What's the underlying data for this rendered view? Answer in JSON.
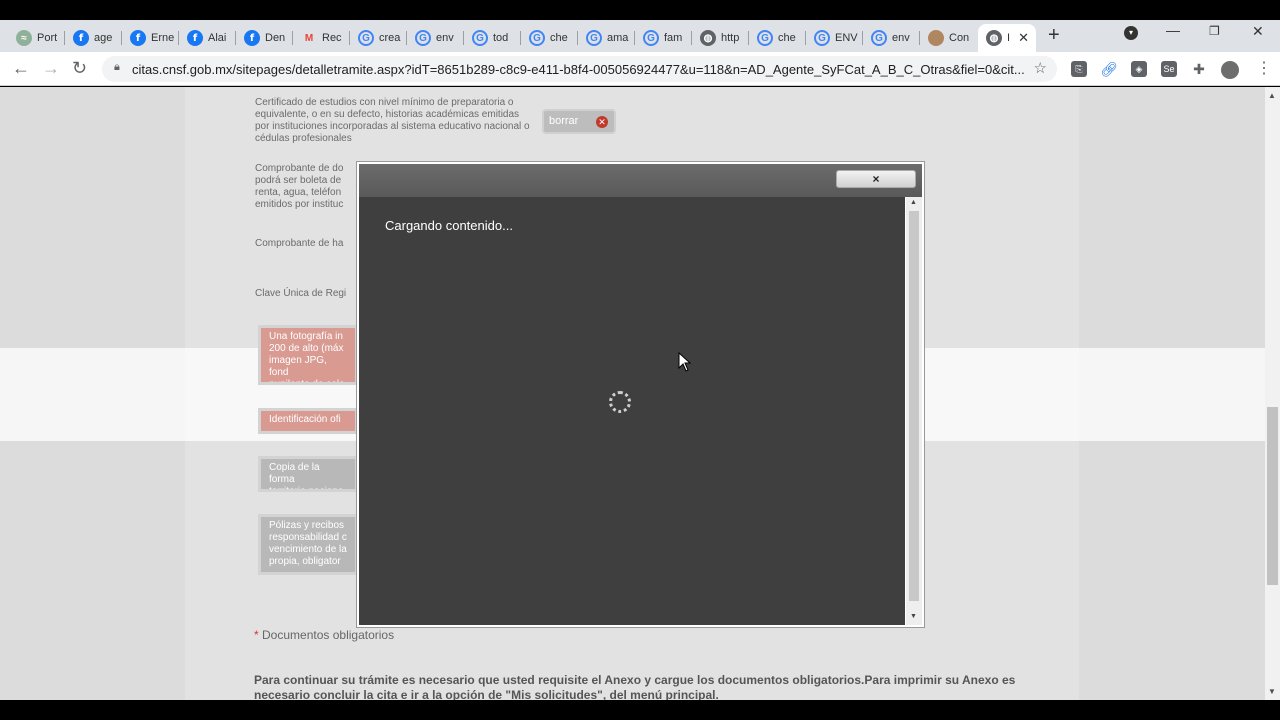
{
  "browser": {
    "tabs": [
      {
        "label": "Port",
        "icon": "meadow-logo-icon"
      },
      {
        "label": "age",
        "icon": "facebook-icon"
      },
      {
        "label": "Erne",
        "icon": "facebook-icon"
      },
      {
        "label": "Alai",
        "icon": "facebook-icon"
      },
      {
        "label": "Den",
        "icon": "facebook-icon"
      },
      {
        "label": "Rec",
        "icon": "gmail-icon"
      },
      {
        "label": "crea",
        "icon": "google-icon"
      },
      {
        "label": "env",
        "icon": "google-icon"
      },
      {
        "label": "tod",
        "icon": "google-icon"
      },
      {
        "label": "che",
        "icon": "google-icon"
      },
      {
        "label": "ama",
        "icon": "google-icon"
      },
      {
        "label": "fam",
        "icon": "google-icon"
      },
      {
        "label": "http",
        "icon": "globe-icon"
      },
      {
        "label": "che",
        "icon": "google-icon"
      },
      {
        "label": "ENV",
        "icon": "google-icon"
      },
      {
        "label": "env",
        "icon": "google-icon"
      },
      {
        "label": "Con",
        "icon": "circle-icon"
      },
      {
        "label": "I",
        "icon": "globe-icon"
      }
    ],
    "url": "citas.cnsf.gob.mx/sitepages/detalletramite.aspx?idT=8651b289-c8c9-e411-b8f4-005056924477&u=118&n=AD_Agente_SyFCat_A_B_C_Otras&fiel=0&cit..."
  },
  "page": {
    "doc_certificado": "Certificado de estudios con nivel mínimo de preparatoria o equivalente, o en su defecto, historias académicas emitidas por instituciones incorporadas al sistema educativo nacional o cédulas profesionales",
    "borrar_label": "borrar",
    "doc_comprobante_dom": "Comprobante de do\npodrá ser boleta de\nrenta, agua, teléfon\nemitidos por instituc",
    "doc_comprobante_ha": "Comprobante de ha",
    "doc_curp": "Clave Única de Regi",
    "req_foto": "Una fotografía in\n200 de alto (máx\nimagen JPG, fond\npupilente de colo",
    "req_identificacion": "Identificación ofi",
    "req_copia": "Copia de la forma\nterritorio naciona",
    "req_polizas": "Pólizas y recibos\nresponsabilidad c\nvencimiento de la\npropia, obligator",
    "oblig_asterisk": "*",
    "oblig_label": "Documentos obligatorios",
    "instructions": "Para continuar su trámite es necesario que usted requisite el Anexo y cargue los documentos obligatorios.Para imprimir su Anexo es necesario concluir la cita e ir a la opción de \"Mis solicitudes\", del menú principal."
  },
  "modal": {
    "close_label": "×",
    "loading_text": "Cargando contenido..."
  }
}
